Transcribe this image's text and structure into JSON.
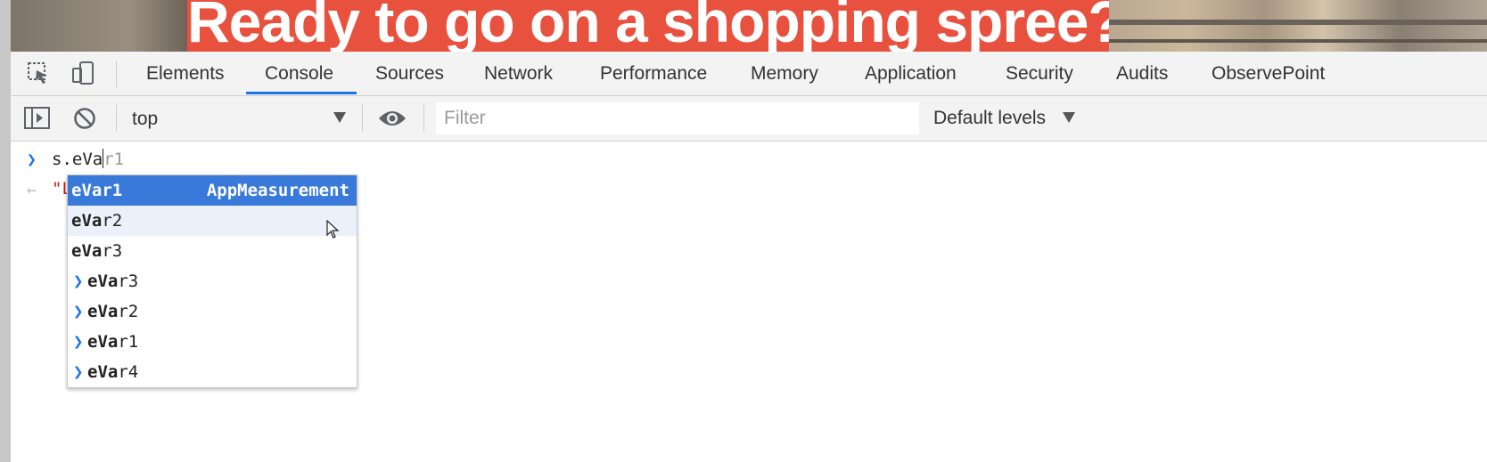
{
  "banner": {
    "headline": "Ready to go on a shopping spree?"
  },
  "devtools": {
    "tabs": [
      {
        "label": "Elements"
      },
      {
        "label": "Console"
      },
      {
        "label": "Sources"
      },
      {
        "label": "Network"
      },
      {
        "label": "Performance"
      },
      {
        "label": "Memory"
      },
      {
        "label": "Application"
      },
      {
        "label": "Security"
      },
      {
        "label": "Audits"
      },
      {
        "label": "ObservePoint"
      }
    ],
    "active_tab": "Console"
  },
  "toolbar": {
    "context": "top",
    "filter_placeholder": "Filter",
    "levels": "Default levels"
  },
  "console": {
    "input_typed": "s.eVa",
    "input_ghost": "r1",
    "result_prefix": "\"L"
  },
  "autocomplete": {
    "items": [
      {
        "match": "eVar",
        "rest": "1",
        "source": "AppMeasurement",
        "expandable": false
      },
      {
        "match": "eVa",
        "rest": "r2",
        "source": "",
        "expandable": false
      },
      {
        "match": "eVa",
        "rest": "r3",
        "source": "",
        "expandable": false
      },
      {
        "match": "eVa",
        "rest": "r3",
        "source": "",
        "expandable": true
      },
      {
        "match": "eVa",
        "rest": "r2",
        "source": "",
        "expandable": true
      },
      {
        "match": "eVa",
        "rest": "r1",
        "source": "",
        "expandable": true
      },
      {
        "match": "eVa",
        "rest": "r4",
        "source": "",
        "expandable": true
      }
    ],
    "selected_index": 0,
    "hovered_index": 1
  },
  "colors": {
    "accent": "#1a73e8",
    "selection": "#3879d9",
    "banner_red": "#e9513f",
    "string_red": "#c41a16"
  }
}
